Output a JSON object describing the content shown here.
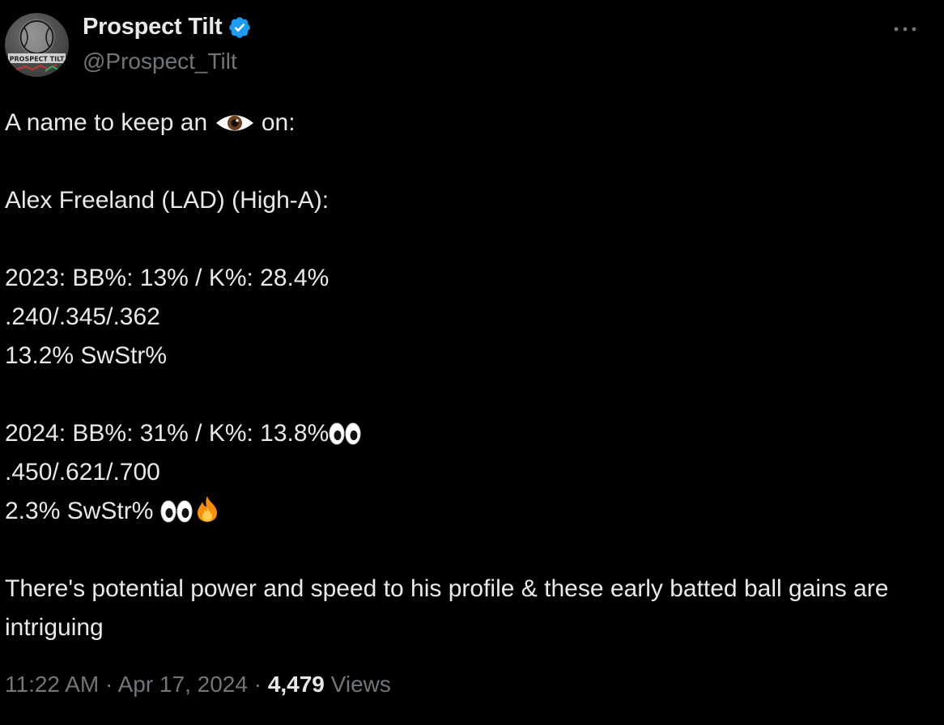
{
  "author": {
    "display_name": "Prospect Tilt",
    "handle": "@Prospect_Tilt",
    "verified": true,
    "verified_color": "#1d9bf0",
    "avatar_text": "PROSPECT TILT",
    "avatar_icon": "baseball-logo"
  },
  "more_icon": "ellipsis-icon",
  "tweet": {
    "line1_before": "A name to keep an",
    "line1_after": "on:",
    "line2": "Alex Freeland (LAD) (High-A):",
    "line3": "2023: BB%: 13% / K%: 28.4%",
    "line4": ".240/.345/.362",
    "line5": "13.2% SwStr%",
    "line6": "2024: BB%: 31% / K%: 13.8%",
    "line7": ".450/.621/.700",
    "line8": "2.3% SwStr%",
    "line9": "There's potential power and speed to his profile & these early batted ball gains are intriguing"
  },
  "emojis": {
    "eye": "eye-emoji",
    "eyes": "eyes-emoji",
    "fire": "fire-emoji"
  },
  "meta": {
    "time": "11:22 AM",
    "separator": "·",
    "date": "Apr 17, 2024",
    "views_count": "4,479",
    "views_label": "Views"
  }
}
